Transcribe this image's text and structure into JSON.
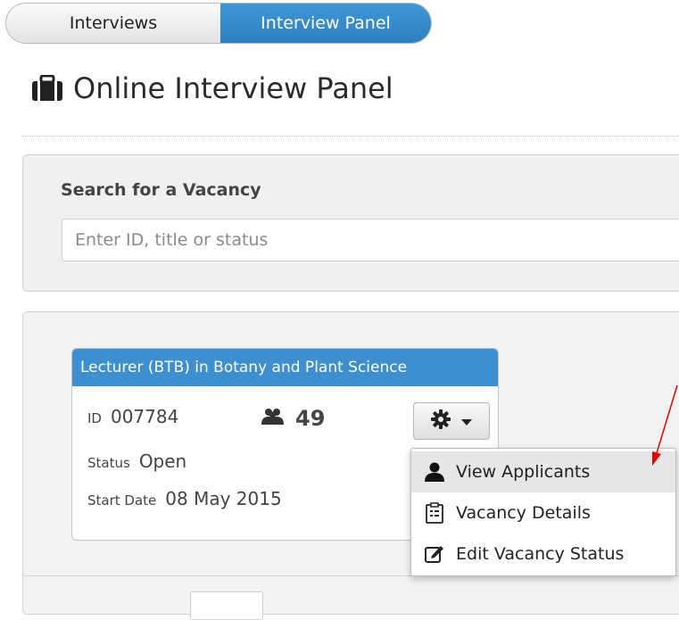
{
  "tabs": [
    {
      "label": "Interviews",
      "active": false
    },
    {
      "label": "Interview Panel",
      "active": true
    }
  ],
  "page": {
    "title": "Online Interview Panel",
    "title_icon": "briefcase-icon"
  },
  "search": {
    "label": "Search for a Vacancy",
    "placeholder": "Enter ID, title or status",
    "value": ""
  },
  "vacancy": {
    "title": "Lecturer (BTB) in Botany and Plant Science",
    "id_label": "ID",
    "id": "007784",
    "applicant_icon": "users-icon",
    "applicant_count": "49",
    "status_label": "Status",
    "status": "Open",
    "start_label": "Start Date",
    "start_date": "08 May 2015",
    "actions_icon": "gear-icon"
  },
  "menu": {
    "items": [
      {
        "label": "View Applicants",
        "icon": "user-icon",
        "highlighted": true
      },
      {
        "label": "Vacancy Details",
        "icon": "clipboard-icon",
        "highlighted": false
      },
      {
        "label": "Edit Vacancy Status",
        "icon": "edit-icon",
        "highlighted": false
      }
    ]
  },
  "colors": {
    "accent_blue": "#3d8fd0",
    "annotation_arrow": "#e00000",
    "menu_hover": "#e6e6e6"
  }
}
